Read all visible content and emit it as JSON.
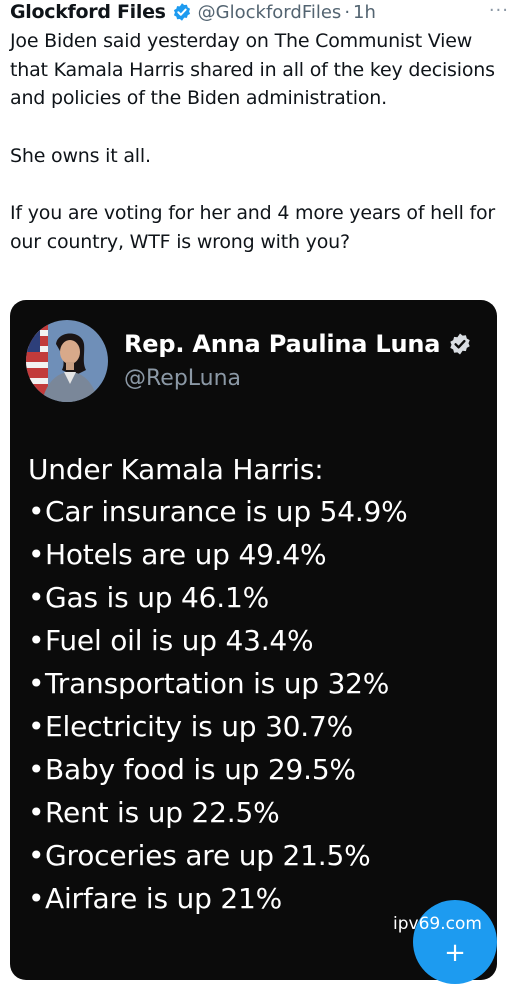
{
  "tweet": {
    "author_name": "Glockford Files",
    "handle": "@GlockfordFiles",
    "separator": "·",
    "time": "1h",
    "more_label": "···",
    "paragraphs": [
      "Joe Biden said yesterday on The Communist View that Kamala Harris shared in all of the key decisions and policies of the Biden administration.",
      "She owns it all.",
      "If you are voting for her and 4 more years of hell for our country, WTF is wrong with you?"
    ]
  },
  "embedded_card": {
    "author_name": "Rep. Anna Paulina Luna",
    "handle": "@RepLuna",
    "list_title": "Under Kamala Harris:",
    "bullet": "•",
    "items": [
      "Car insurance is up 54.9%",
      "Hotels are up 49.4%",
      "Gas is up 46.1%",
      "Fuel oil is up 43.4%",
      "Transportation is up 32%",
      "Electricity is up 30.7%",
      "Baby food is up 29.5%",
      "Rent is up 22.5%",
      "Groceries are up 21.5%",
      "Airfare is up 21%"
    ]
  },
  "icons": {
    "verified": "verified-badge-icon",
    "compose": "compose-button"
  },
  "colors": {
    "verified_blue": "#1d9bf0",
    "card_background": "#0b0b0b",
    "muted_text": "#536471"
  },
  "watermark": "ipv69.com"
}
